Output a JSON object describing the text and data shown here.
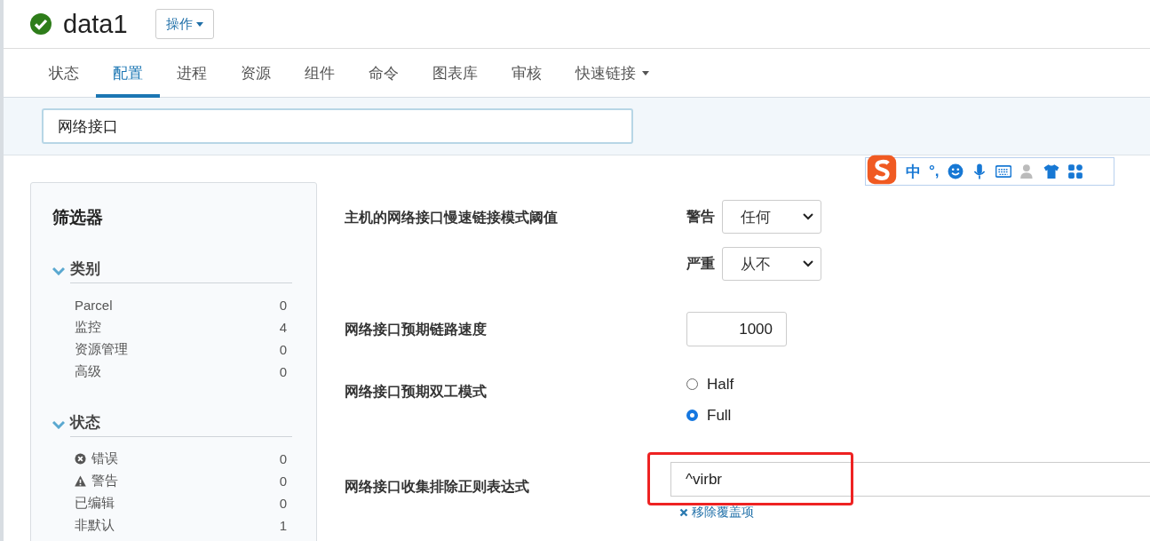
{
  "header": {
    "title": "data1",
    "actions_button": "操作"
  },
  "tabs": [
    {
      "label": "状态",
      "selected": false,
      "dropdown": false
    },
    {
      "label": "配置",
      "selected": true,
      "dropdown": false
    },
    {
      "label": "进程",
      "selected": false,
      "dropdown": false
    },
    {
      "label": "资源",
      "selected": false,
      "dropdown": false
    },
    {
      "label": "组件",
      "selected": false,
      "dropdown": false
    },
    {
      "label": "命令",
      "selected": false,
      "dropdown": false
    },
    {
      "label": "图表库",
      "selected": false,
      "dropdown": false
    },
    {
      "label": "审核",
      "selected": false,
      "dropdown": false
    },
    {
      "label": "快速链接",
      "selected": false,
      "dropdown": true
    }
  ],
  "search": {
    "value": "网络接口"
  },
  "sidebar": {
    "title": "筛选器",
    "groups": [
      {
        "title": "类别",
        "expanded": true,
        "items": [
          {
            "label": "Parcel",
            "count": "0"
          },
          {
            "label": "监控",
            "count": "4"
          },
          {
            "label": "资源管理",
            "count": "0"
          },
          {
            "label": "高级",
            "count": "0"
          }
        ]
      },
      {
        "title": "状态",
        "expanded": true,
        "items": [
          {
            "label": "错误",
            "count": "0",
            "kind": "error"
          },
          {
            "label": "警告",
            "count": "0",
            "kind": "warning"
          },
          {
            "label": "已编辑",
            "count": "0"
          },
          {
            "label": "非默认",
            "count": "1"
          }
        ]
      }
    ]
  },
  "settings": [
    {
      "kind": "selects",
      "label": "主机的网络接口慢速链接模式阈值",
      "selects": [
        {
          "label": "警告",
          "value": "任何"
        },
        {
          "label": "严重",
          "value": "从不"
        }
      ]
    },
    {
      "kind": "number",
      "label": "网络接口预期链路速度",
      "value": "1000"
    },
    {
      "kind": "radio",
      "label": "网络接口预期双工模式",
      "options": [
        {
          "label": "Half",
          "selected": false
        },
        {
          "label": "Full",
          "selected": true
        }
      ]
    },
    {
      "kind": "text",
      "label": "网络接口收集排除正则表达式",
      "value": "^virbr",
      "highlighted": true,
      "link": "移除覆盖项"
    }
  ],
  "ime_toolbar": {
    "items": [
      "中",
      "°,"
    ]
  }
}
